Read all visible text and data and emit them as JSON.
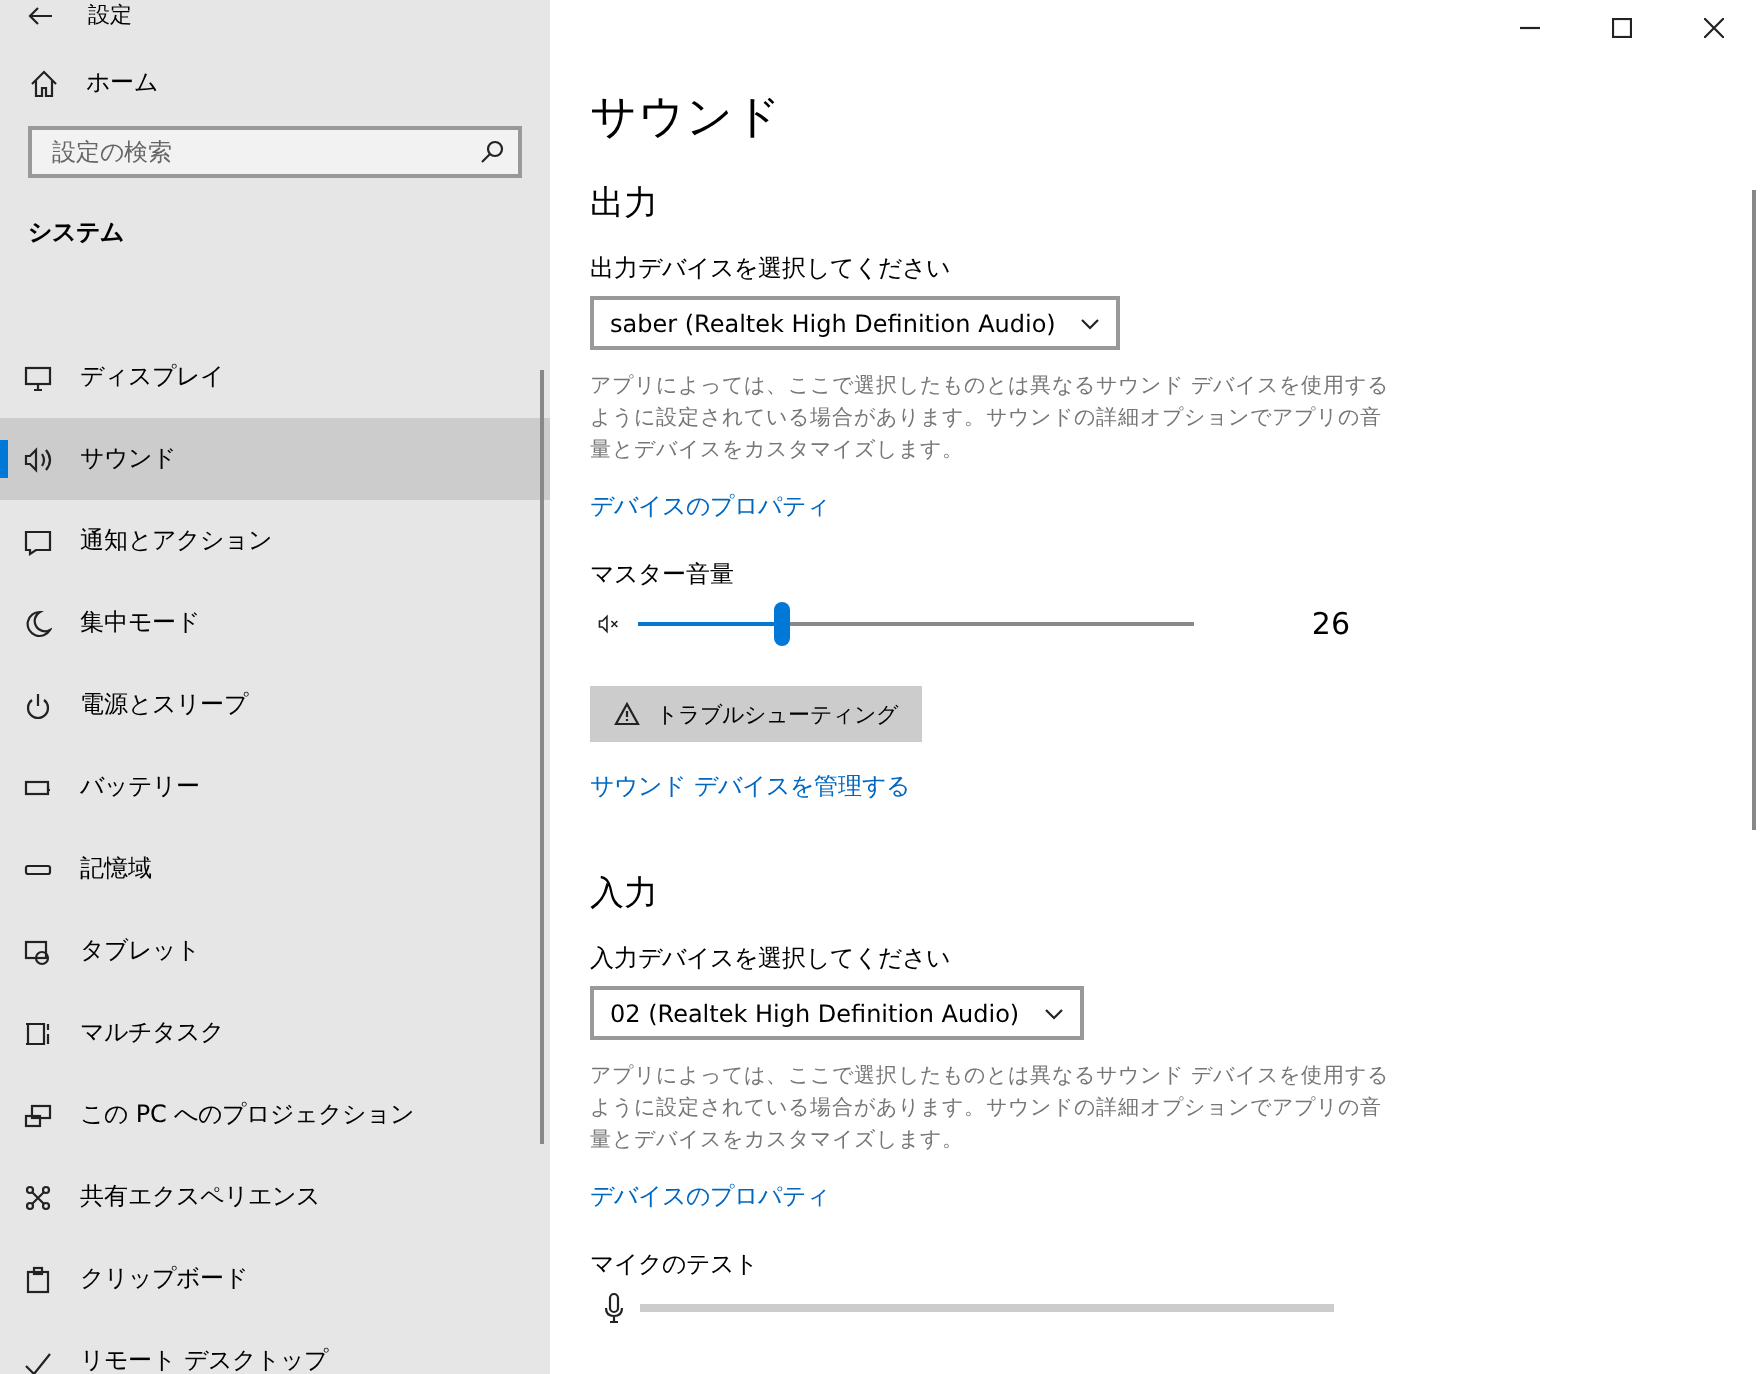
{
  "window": {
    "title": "設定"
  },
  "sidebar": {
    "home": "ホーム",
    "search": {
      "placeholder": "設定の検索"
    },
    "section": "システム",
    "items": [
      {
        "label": "ディスプレイ",
        "selected": false
      },
      {
        "label": "サウンド",
        "selected": true
      },
      {
        "label": "通知とアクション",
        "selected": false
      },
      {
        "label": "集中モード",
        "selected": false
      },
      {
        "label": "電源とスリープ",
        "selected": false
      },
      {
        "label": "バッテリー",
        "selected": false
      },
      {
        "label": "記憶域",
        "selected": false
      },
      {
        "label": "タブレット",
        "selected": false
      },
      {
        "label": "マルチタスク",
        "selected": false
      },
      {
        "label": "この PC へのプロジェクション",
        "selected": false
      },
      {
        "label": "共有エクスペリエンス",
        "selected": false
      },
      {
        "label": "クリップボード",
        "selected": false
      },
      {
        "label": "リモート デスクトップ",
        "selected": false
      }
    ]
  },
  "page": {
    "title": "サウンド",
    "output": {
      "heading": "出力",
      "device_label": "出力デバイスを選択してください",
      "device": "saber (Realtek High Definition Audio)",
      "description": "アプリによっては、ここで選択したものとは異なるサウンド デバイスを使用するように設定されている場合があります。サウンドの詳細オプションでアプリの音量とデバイスをカスタマイズします。",
      "properties_link": "デバイスのプロパティ",
      "volume_label": "マスター音量",
      "volume": {
        "level": 0.26,
        "reading": "26"
      },
      "troubleshoot": "トラブルシューティング",
      "manage_link": "サウンド デバイスを管理する"
    },
    "input": {
      "heading": "入力",
      "device_label": "入力デバイスを選択してください",
      "device": "02 (Realtek High Definition Audio)",
      "description": "アプリによっては、ここで選択したものとは異なるサウンド デバイスを使用するように設定されている場合があります。サウンドの詳細オプションでアプリの音量とデバイスをカスタマイズします。",
      "properties_link": "デバイスのプロパティ",
      "mic_label": "マイクのテスト",
      "mic_meter": {
        "level": 0
      }
    }
  }
}
